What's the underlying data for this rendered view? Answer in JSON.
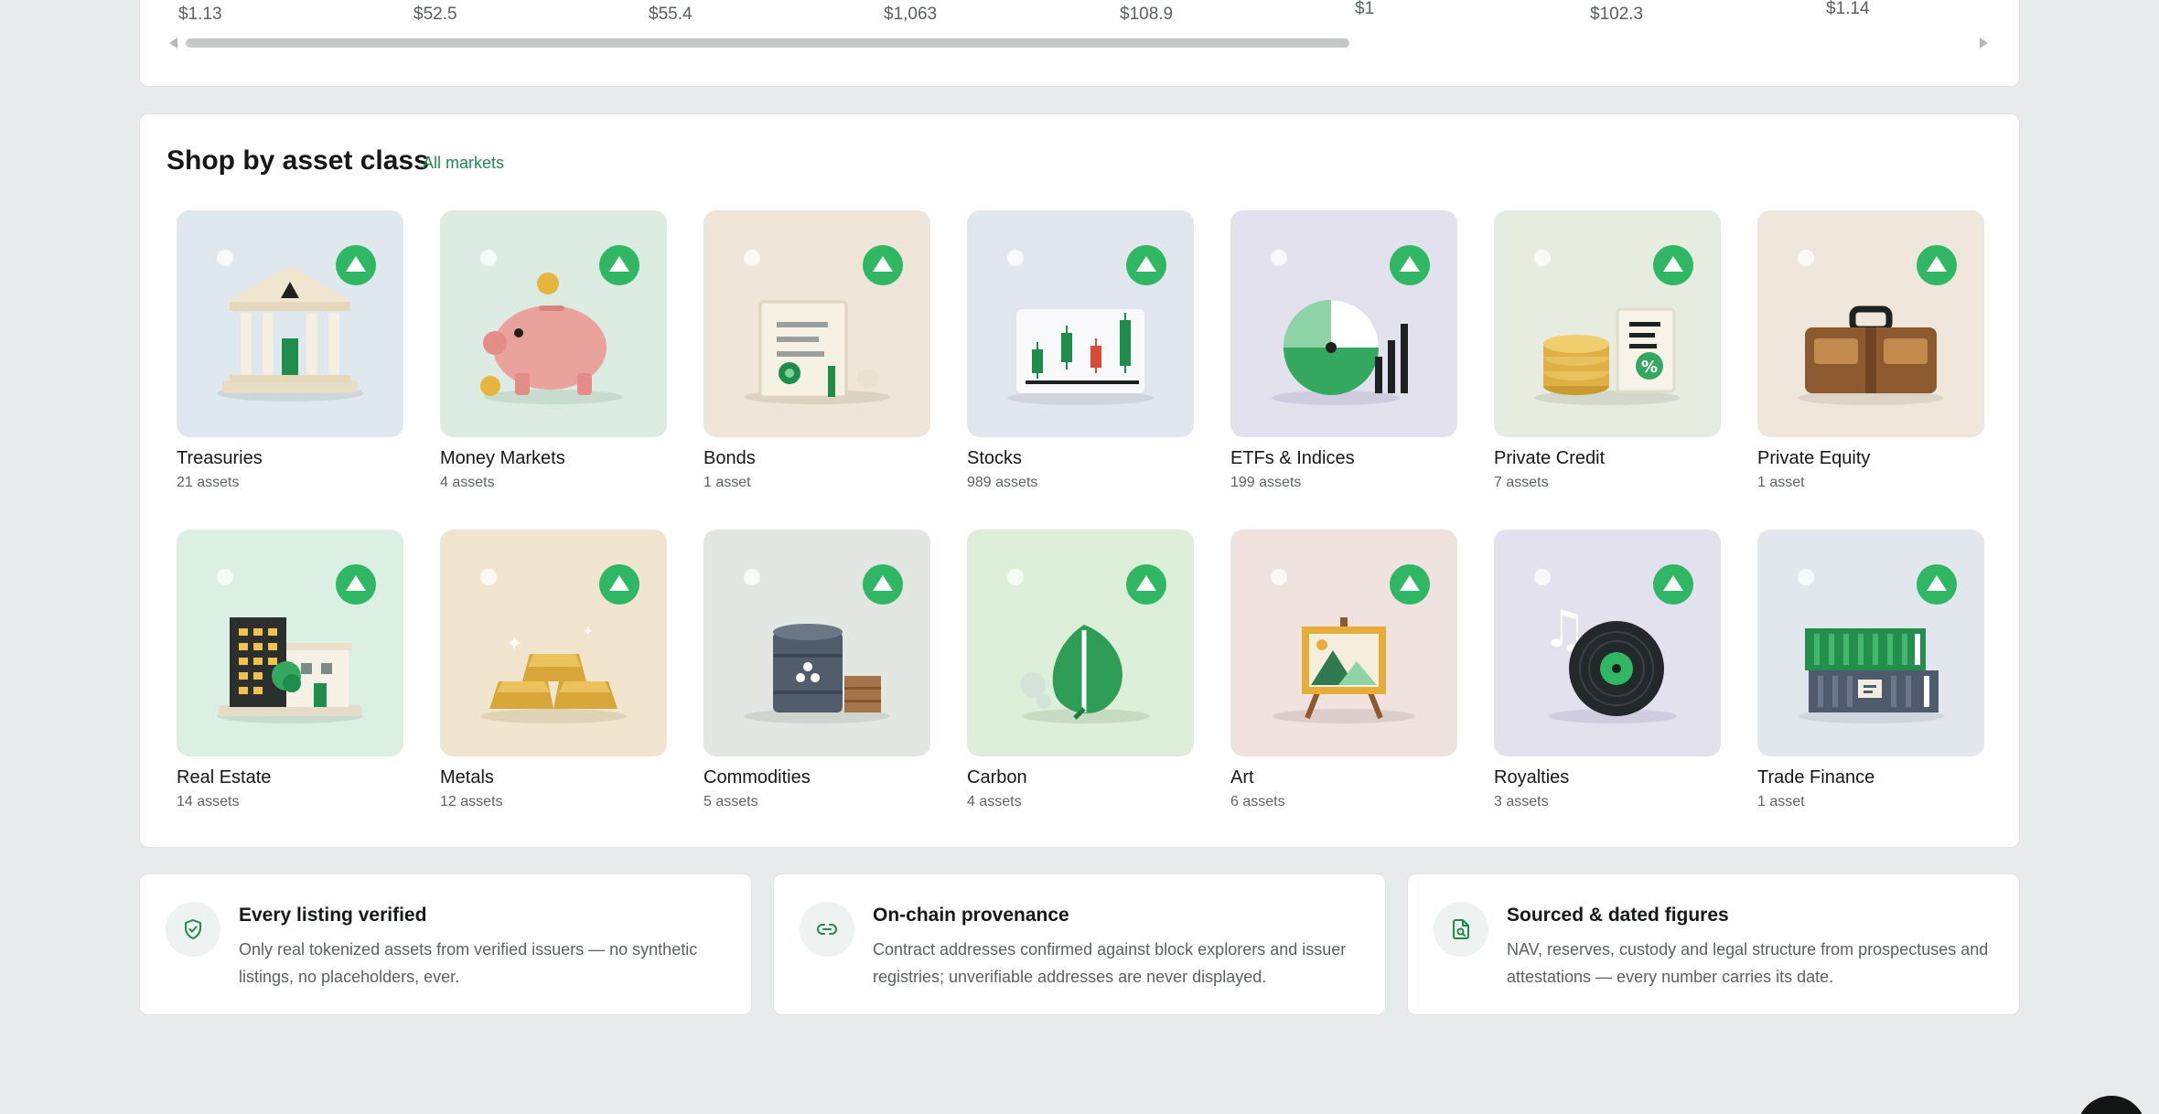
{
  "prices": [
    "$1.13",
    "$52.5",
    "$55.4",
    "$1,063",
    "$108.9",
    "$1",
    "$102.3",
    "$1.14"
  ],
  "shop": {
    "title": "Shop by asset class",
    "all_markets": "All markets",
    "tiles": [
      {
        "name": "Treasuries",
        "count": "21 assets",
        "icon": "bank-building-icon"
      },
      {
        "name": "Money Markets",
        "count": "4 assets",
        "icon": "piggy-bank-icon"
      },
      {
        "name": "Bonds",
        "count": "1 asset",
        "icon": "bond-certificate-icon"
      },
      {
        "name": "Stocks",
        "count": "989 assets",
        "icon": "candlestick-chart-icon"
      },
      {
        "name": "ETFs & Indices",
        "count": "199 assets",
        "icon": "pie-chart-icon"
      },
      {
        "name": "Private Credit",
        "count": "7 assets",
        "icon": "coins-document-icon"
      },
      {
        "name": "Private Equity",
        "count": "1 asset",
        "icon": "briefcase-icon"
      },
      {
        "name": "Real Estate",
        "count": "14 assets",
        "icon": "buildings-icon"
      },
      {
        "name": "Metals",
        "count": "12 assets",
        "icon": "gold-bars-icon"
      },
      {
        "name": "Commodities",
        "count": "5 assets",
        "icon": "oil-barrel-icon"
      },
      {
        "name": "Carbon",
        "count": "4 assets",
        "icon": "leaf-icon"
      },
      {
        "name": "Art",
        "count": "6 assets",
        "icon": "painting-easel-icon"
      },
      {
        "name": "Royalties",
        "count": "3 assets",
        "icon": "vinyl-record-icon"
      },
      {
        "name": "Trade Finance",
        "count": "1 asset",
        "icon": "shipping-containers-icon"
      }
    ]
  },
  "features": [
    {
      "title": "Every listing verified",
      "desc": "Only real tokenized assets from verified issuers — no synthetic listings, no placeholders, ever.",
      "icon": "shield-check-icon"
    },
    {
      "title": "On-chain provenance",
      "desc": "Contract addresses confirmed against block explorers and issuer registries; unverifiable addresses are never displayed.",
      "icon": "link-icon"
    },
    {
      "title": "Sourced & dated figures",
      "desc": "NAV, reserves, custody and legal structure from prospectuses and attestations — every number carries its date.",
      "icon": "document-search-icon"
    }
  ],
  "colors": {
    "accent": "#2fb763",
    "link": "#1f8a4c"
  }
}
